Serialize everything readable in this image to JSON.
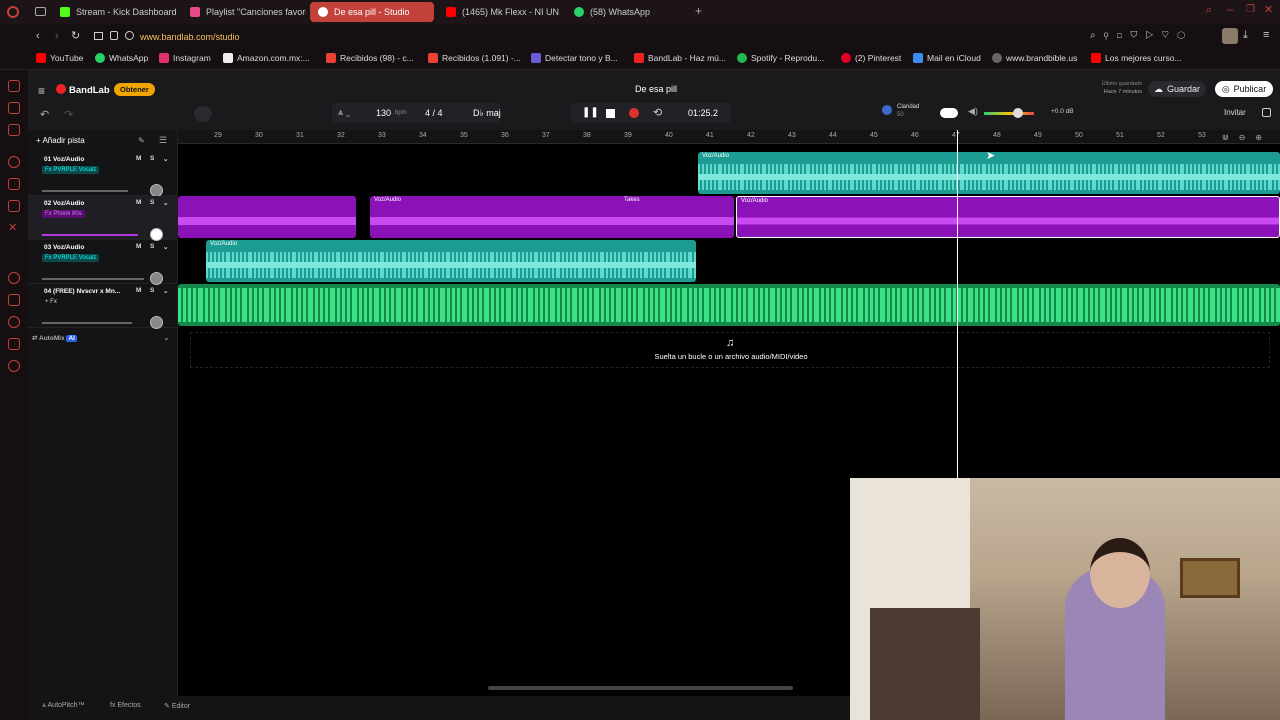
{
  "browser": {
    "tabs": [
      {
        "label": "Stream - Kick Dashboard",
        "color": "#53fc18"
      },
      {
        "label": "Playlist \"Canciones favori",
        "color": "#e84a8a"
      },
      {
        "label": "De esa pill - Studio",
        "color": "#ffffff",
        "active": true
      },
      {
        "label": "(1465) Mk Flexx - NI UN P",
        "color": "#ff0000"
      },
      {
        "label": "(58) WhatsApp",
        "color": "#25d366"
      }
    ],
    "url": "www.bandlab.com/studio",
    "bookmarks": [
      "YouTube",
      "WhatsApp",
      "Instagram",
      "Amazon.com.mx:...",
      "Recibidos (98) - c...",
      "Recibidos (1.091) -...",
      "Detectar tono y B...",
      "BandLab - Haz mú...",
      "Spotify - Reprodu...",
      "(2) Pinterest",
      "Mail en iCloud",
      "www.brandbible.us",
      "Los mejores curso..."
    ]
  },
  "studio": {
    "logo": "BandLab",
    "get_badge": "Obtener",
    "project_title": "De esa pill",
    "tempo": "130",
    "tempo_unit": "bpm",
    "time_sig": "4 / 4",
    "key": "D♭ maj",
    "time": "01:25.2",
    "clarity_label": "Claridad",
    "clarity_value": "50",
    "gain": "+0.0 dB",
    "last_saved": "Último guardado",
    "last_saved_time": "Hace 7 minutos",
    "save_label": "Guardar",
    "publish_label": "Publicar",
    "invite_label": "Invitar",
    "add_track": "Añadir pista",
    "automix": "AutoMix",
    "drop_hint": "Suelta un bucle o un archivo audio/MIDI/video",
    "bottom": {
      "autopitch": "AutoPitch™",
      "effects": "Efectos",
      "editor": "Editor"
    }
  },
  "ruler": [
    "29",
    "30",
    "31",
    "32",
    "33",
    "34",
    "35",
    "36",
    "37",
    "38",
    "39",
    "40",
    "41",
    "42",
    "43",
    "44",
    "45",
    "46",
    "47",
    "48",
    "49",
    "50",
    "51",
    "52",
    "53"
  ],
  "tracks": [
    {
      "name": "01  Voz/Audio",
      "fx": "Fx PVRPLE Vocalz",
      "mute": "M",
      "solo": "S",
      "volume": 0.72
    },
    {
      "name": "02  Voz/Audio",
      "fx": "Fx Phonk 80s",
      "mute": "M",
      "solo": "S",
      "volume": 0.8
    },
    {
      "name": "03  Voz/Audio",
      "fx": "Fx PVRPLE Vocalz",
      "mute": "M",
      "solo": "S",
      "volume": 0.85
    },
    {
      "name": "04  (FREE) Nvscvr x Mn...",
      "fx": "+ Fx",
      "mute": "M",
      "solo": "S",
      "volume": 0.75
    }
  ],
  "clip_label": "Voz/Audio",
  "takes_label": "Takes",
  "colors": {
    "teal": "#1c9c92",
    "purple": "#8a12b6",
    "green": "#138a4a",
    "accent": "#c2413a"
  }
}
